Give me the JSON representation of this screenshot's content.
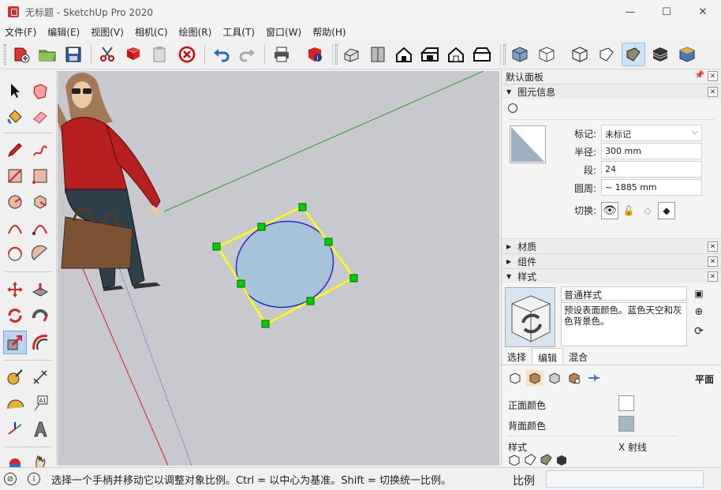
{
  "window": {
    "title": "无标题 - SketchUp Pro 2020",
    "minimize": "—",
    "maximize": "☐",
    "close": "✕"
  },
  "menu": [
    "文件(F)",
    "编辑(E)",
    "视图(V)",
    "相机(C)",
    "绘图(R)",
    "工具(T)",
    "窗口(W)",
    "帮助(H)"
  ],
  "tray": {
    "title": "默认面板",
    "entity_info": {
      "header": "图元信息",
      "tag_label": "标记:",
      "tag_value": "未标记",
      "radius_label": "半径:",
      "radius_value": "300 mm",
      "segments_label": "段:",
      "segments_value": "24",
      "circumference_label": "圆周:",
      "circumference_value": "~ 1885 mm",
      "toggle_label": "切换:"
    },
    "materials_header": "材质",
    "components_header": "组件",
    "styles": {
      "header": "样式",
      "name": "普通样式",
      "description": "预设表面颜色。蓝色天空和灰色背景色。",
      "tabs": [
        "选择",
        "编辑",
        "混合"
      ],
      "active_tab": "编辑",
      "face_label": "平面",
      "front_color_label": "正面颜色",
      "back_color_label": "背面颜色",
      "style_label": "样式",
      "xray_label": "X 射线"
    }
  },
  "colors": {
    "front_face": "#ffffff",
    "back_face": "#a4b7c7",
    "selection": "#ffff00",
    "grip": "#00d000",
    "circle_fill": "#a7c3d9",
    "circle_edge": "#1f2fcc",
    "green_axis": "#2aa02a",
    "red_axis": "#d02020",
    "blue_axis": "#2020c0",
    "viewport_bg": "#c8c9cf"
  },
  "status": {
    "message": "选择一个手柄并移动它以调整对象比例。Ctrl = 以中心为基准。Shift = 切换统一比例。",
    "measure_label": "比例",
    "measure_value": ""
  }
}
